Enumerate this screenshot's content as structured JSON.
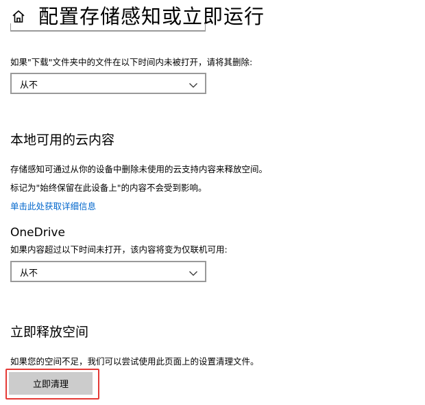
{
  "header": {
    "icon": "home-icon",
    "title": "配置存储感知或立即运行"
  },
  "downloads": {
    "label": "如果\"下载\"文件夹中的文件在以下时间内未被打开，请将其删除:",
    "selected": "从不"
  },
  "cloud": {
    "heading": "本地可用的云内容",
    "description1": "存储感知可通过从你的设备中删除未使用的云支持内容来释放空间。",
    "description2": "标记为\"始终保留在此设备上\"的内容不会受到影响。",
    "link": "单击此处获取详细信息"
  },
  "onedrive": {
    "title": "OneDrive",
    "label": "如果内容超过以下时间未打开，该内容将变为仅联机可用:",
    "selected": "从不"
  },
  "free_space": {
    "heading": "立即释放空间",
    "description": "如果您的空间不足，我们可以尝试使用此页面上的设置清理文件。",
    "button_label": "立即清理"
  },
  "colors": {
    "link": "#0066cc",
    "button_bg": "#cccccc",
    "highlight": "#e53935",
    "dropdown_border": "#999999"
  }
}
